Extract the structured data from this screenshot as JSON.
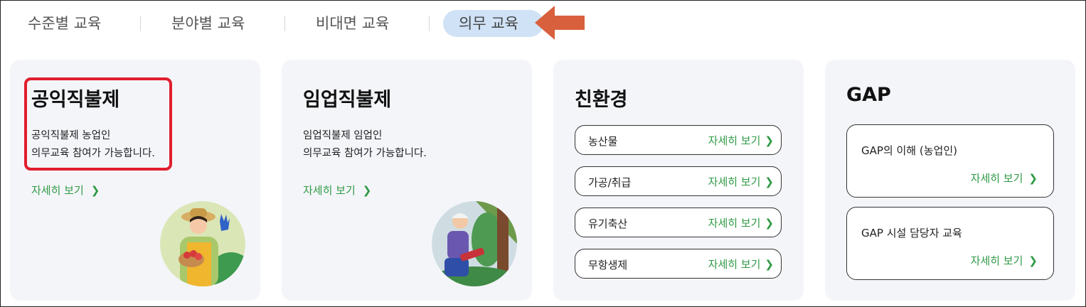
{
  "tabs": [
    {
      "label": "수준별 교육"
    },
    {
      "label": "분야별 교육"
    },
    {
      "label": "비대면 교육"
    },
    {
      "label": "의무 교육"
    }
  ],
  "cards": {
    "public": {
      "title": "공익직불제",
      "desc_line1": "공익직불제 농업인",
      "desc_line2": "의무교육 참여가 가능합니다.",
      "more": "자세히 보기"
    },
    "forestry": {
      "title": "임업직불제",
      "desc_line1": "임업직불제 임업인",
      "desc_line2": "의무교육 참여가 가능합니다.",
      "more": "자세히 보기"
    },
    "eco": {
      "title": "친환경",
      "items": [
        {
          "label": "농산물",
          "more": "자세히 보기"
        },
        {
          "label": "가공/취급",
          "more": "자세히 보기"
        },
        {
          "label": "유기축산",
          "more": "자세히 보기"
        },
        {
          "label": "무항생제",
          "more": "자세히 보기"
        }
      ]
    },
    "gap": {
      "title": "GAP",
      "items": [
        {
          "label": "GAP의 이해 (농업인)",
          "more": "자세히 보기"
        },
        {
          "label": "GAP 시설 담당자 교육",
          "more": "자세히 보기"
        }
      ]
    }
  },
  "icons": {
    "chevron": "chevron-right-icon",
    "arrow": "arrow-left-icon",
    "farmer": "farmer-illustration",
    "forester": "forester-illustration"
  },
  "colors": {
    "accent_green": "#2f9a45",
    "active_tab_bg": "#cfe2f6",
    "card_bg": "#f4f5f9",
    "highlight_red": "#e01e2e",
    "arrow_orange": "#d9603d"
  }
}
